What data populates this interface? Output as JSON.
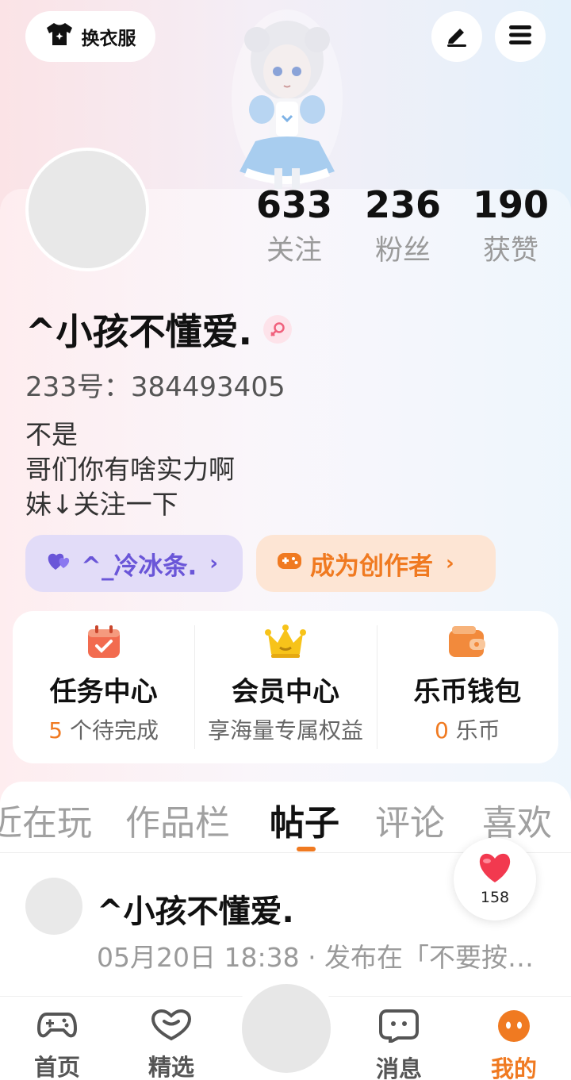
{
  "header": {
    "dress_label": "换衣服",
    "dress_icon": "tshirt-icon",
    "edit_icon": "pen-icon",
    "menu_icon": "menu-icon"
  },
  "profile": {
    "stats": [
      {
        "value": "633",
        "label": "关注"
      },
      {
        "value": "236",
        "label": "粉丝"
      },
      {
        "value": "190",
        "label": "获赞"
      }
    ],
    "username": "^小孩不懂爱.",
    "gender_icon": "female-icon",
    "uid": "233号：384493405",
    "bio": [
      "不是",
      "哥们你有啥实力啊",
      "妹↓关注一下"
    ],
    "friend_pill": "^_冷冰条.",
    "creator_pill": "成为创作者"
  },
  "features": [
    {
      "icon": "calendar-check-icon",
      "title": "任务中心",
      "count": "5",
      "sub": " 个待完成"
    },
    {
      "icon": "crown-icon",
      "title": "会员中心",
      "count": "",
      "sub": "享海量专属权益"
    },
    {
      "icon": "wallet-icon",
      "title": "乐币钱包",
      "count": "0",
      "sub": " 乐币"
    }
  ],
  "tabs": [
    "近在玩",
    "作品栏",
    "帖子",
    "评论",
    "喜欢"
  ],
  "active_tab": "帖子",
  "post": {
    "author": "^小孩不懂爱.",
    "meta": "05月20日 18:38 · 发布在「不要按…"
  },
  "like": {
    "count": "158"
  },
  "nav": [
    {
      "label": "首页",
      "icon": "gamepad-icon"
    },
    {
      "label": "精选",
      "icon": "heart-chat-icon"
    },
    {
      "label": "消息",
      "icon": "message-icon"
    },
    {
      "label": "我的",
      "icon": "profile-face-icon"
    }
  ],
  "colors": {
    "accent": "#f07a21",
    "friend": "#6a56d8",
    "like": "#f2394f"
  }
}
